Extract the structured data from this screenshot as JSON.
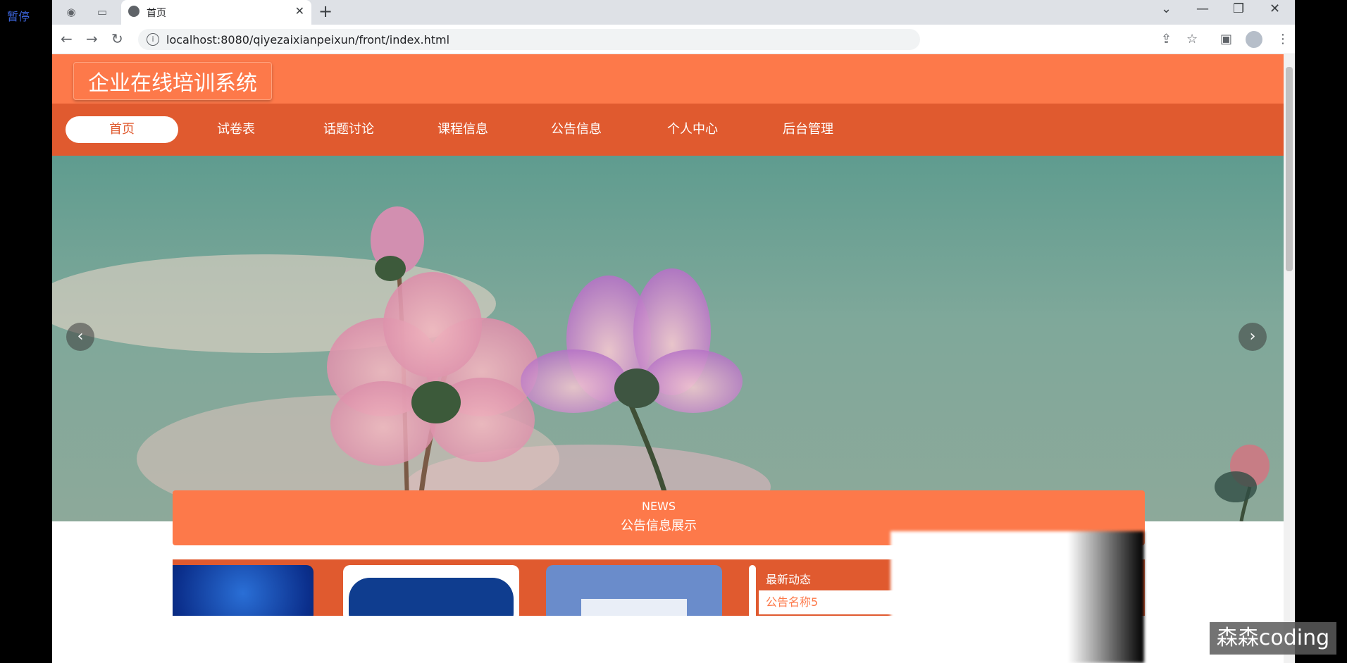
{
  "overlay": {
    "paused_label": "暂停",
    "watermark": "森森coding"
  },
  "browser": {
    "tab_title": "首页",
    "url": "localhost:8080/qiyezaixianpeixun/front/index.html",
    "close_glyph": "✕",
    "newtab_glyph": "+",
    "min_glyph": "—",
    "restore_glyph": "❐",
    "winclose_glyph": "✕",
    "chevron_glyph": "⌄",
    "back_glyph": "←",
    "fwd_glyph": "→",
    "reload_glyph": "↻"
  },
  "site": {
    "title": "企业在线培训系统",
    "menu": [
      "首页",
      "试卷表",
      "话题讨论",
      "课程信息",
      "公告信息",
      "个人中心",
      "后台管理"
    ],
    "news_en": "NEWS",
    "news_cn": "公告信息展示",
    "latest_title": "最新动态",
    "latest_item": "公告名称5",
    "prev_glyph": "‹",
    "next_glyph": "›"
  },
  "colors": {
    "header": "#fd794a",
    "menu": "#e05a2f",
    "accent": "#fd794a"
  },
  "carousel": {
    "slides": 3,
    "active_index": 0
  }
}
